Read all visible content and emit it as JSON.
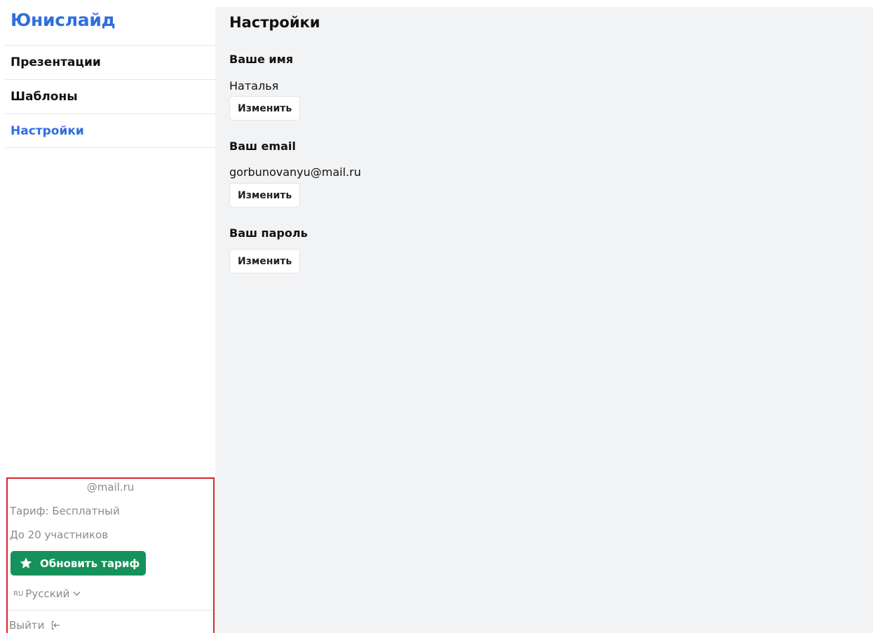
{
  "app": {
    "logo": "Юнислайд"
  },
  "sidebar": {
    "items": [
      {
        "label": "Презентации",
        "active": false
      },
      {
        "label": "Шаблоны",
        "active": false
      },
      {
        "label": "Настройки",
        "active": true
      }
    ]
  },
  "account": {
    "email": "@mail.ru",
    "plan": "Тариф: Бесплатный",
    "limit": "До 20 участников",
    "upgrade_label": "Обновить тариф",
    "lang_code": "RU",
    "lang_label": "Русский",
    "logout_label": "Выйти"
  },
  "main": {
    "title": "Настройки",
    "name_section": {
      "label": "Ваше имя",
      "value": "Наталья",
      "button": "Изменить"
    },
    "email_section": {
      "label": "Ваш email",
      "value": "gorbunovanyu@mail.ru",
      "button": "Изменить"
    },
    "password_section": {
      "label": "Ваш пароль",
      "button": "Изменить"
    }
  },
  "colors": {
    "brand": "#2f6fde",
    "upgrade": "#15915b",
    "highlight_border": "#e0222a"
  },
  "icons": {
    "upgrade": "star-icon",
    "lang": "chevron-down-icon",
    "logout": "logout-icon"
  }
}
